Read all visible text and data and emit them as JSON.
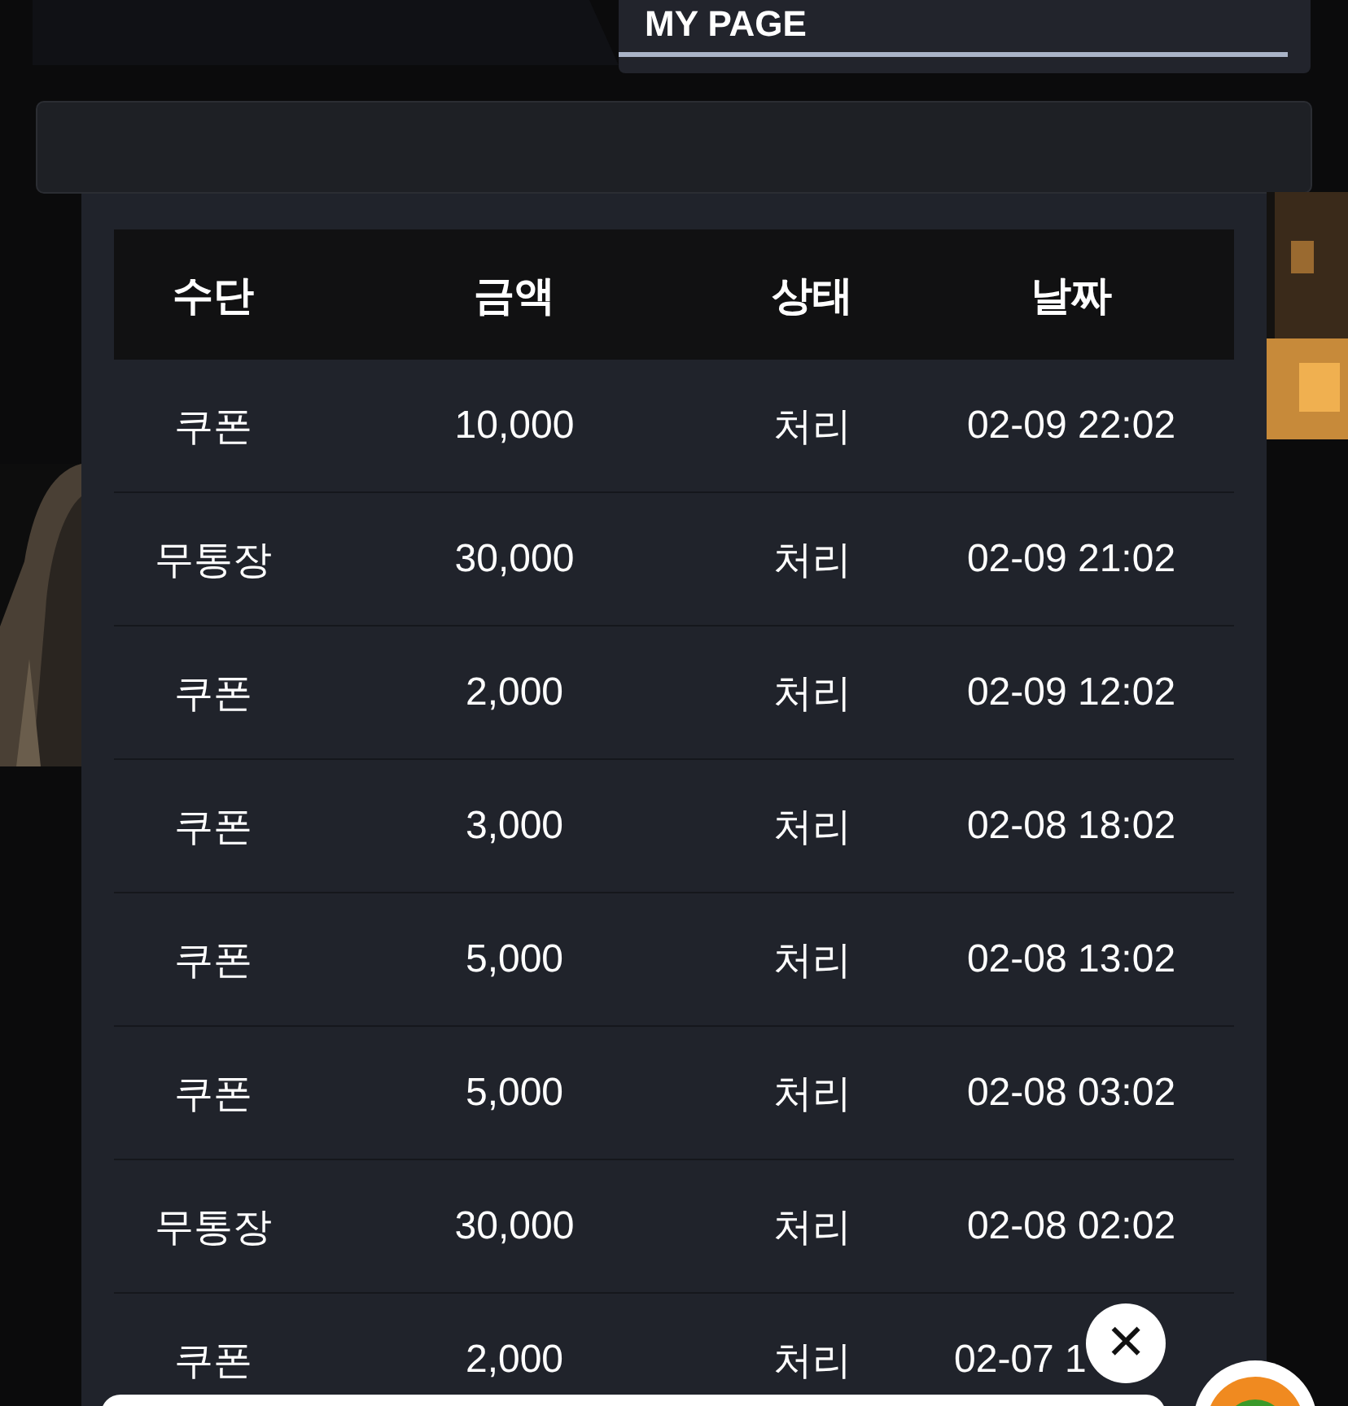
{
  "header": {
    "tab": "MY PAGE"
  },
  "table": {
    "columns": [
      "수단",
      "금액",
      "상태",
      "날짜"
    ],
    "rows": [
      {
        "method": "쿠폰",
        "amount": "10,000",
        "status": "처리",
        "date": "02-09 22:02"
      },
      {
        "method": "무통장",
        "amount": "30,000",
        "status": "처리",
        "date": "02-09 21:02"
      },
      {
        "method": "쿠폰",
        "amount": "2,000",
        "status": "처리",
        "date": "02-09 12:02"
      },
      {
        "method": "쿠폰",
        "amount": "3,000",
        "status": "처리",
        "date": "02-08 18:02"
      },
      {
        "method": "쿠폰",
        "amount": "5,000",
        "status": "처리",
        "date": "02-08 13:02"
      },
      {
        "method": "쿠폰",
        "amount": "5,000",
        "status": "처리",
        "date": "02-08 03:02"
      },
      {
        "method": "무통장",
        "amount": "30,000",
        "status": "처리",
        "date": "02-08 02:02"
      },
      {
        "method": "쿠폰",
        "amount": "2,000",
        "status": "처리",
        "date": "02-07 1"
      }
    ]
  },
  "close_button": {
    "label": "✕"
  }
}
